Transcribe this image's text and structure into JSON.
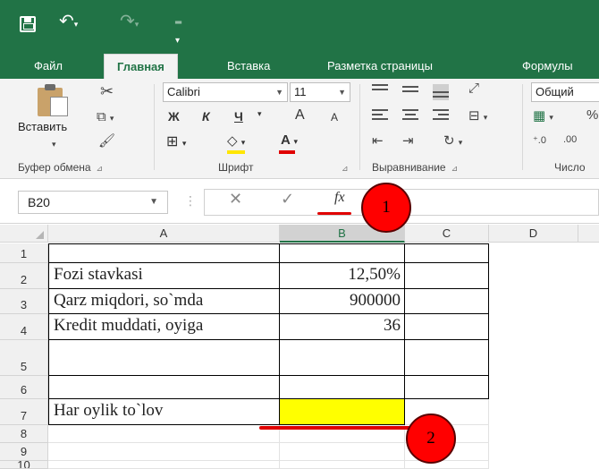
{
  "quick_access": {
    "save_icon": "save-icon",
    "undo_icon": "undo-icon",
    "redo_icon": "redo-icon",
    "customize_icon": "customize-icon"
  },
  "tabs": [
    {
      "label": "Файл",
      "active": false
    },
    {
      "label": "Главная",
      "active": true
    },
    {
      "label": "Вставка",
      "active": false
    },
    {
      "label": "Разметка страницы",
      "active": false
    },
    {
      "label": "Формулы",
      "active": false
    }
  ],
  "ribbon": {
    "clipboard": {
      "paste_label": "Вставить",
      "group_label": "Буфер обмена"
    },
    "font": {
      "font_name": "Calibri",
      "font_size": "11",
      "bold": "Ж",
      "italic": "К",
      "underline": "Ч",
      "grow": "A",
      "shrink": "A",
      "group_label": "Шрифт"
    },
    "alignment": {
      "group_label": "Выравнивание"
    },
    "number": {
      "format": "Общий",
      "percent": "%",
      "group_label": "Число"
    }
  },
  "formula_bar": {
    "name_box": "B20",
    "fx": "fx",
    "value": ""
  },
  "columns": [
    "A",
    "B",
    "C",
    "D"
  ],
  "rows": [
    {
      "num": "1",
      "a": "",
      "b": ""
    },
    {
      "num": "2",
      "a": "Fozi stavkasi",
      "b": "12,50%"
    },
    {
      "num": "3",
      "a": "Qarz miqdori, so`mda",
      "b": "900000"
    },
    {
      "num": "4",
      "a": "Kredit muddati, oyiga",
      "b": "36"
    },
    {
      "num": "5",
      "a": "",
      "b": ""
    },
    {
      "num": "6",
      "a": "",
      "b": ""
    },
    {
      "num": "7",
      "a": "Har oylik to`lov",
      "b": ""
    },
    {
      "num": "8",
      "a": "",
      "b": ""
    },
    {
      "num": "9",
      "a": "",
      "b": ""
    },
    {
      "num": "10",
      "a": "",
      "b": ""
    }
  ],
  "annotations": [
    "1",
    "2"
  ],
  "colors": {
    "excel_green": "#217346",
    "highlight": "#ffff00",
    "annotation_red": "#ff0000"
  }
}
